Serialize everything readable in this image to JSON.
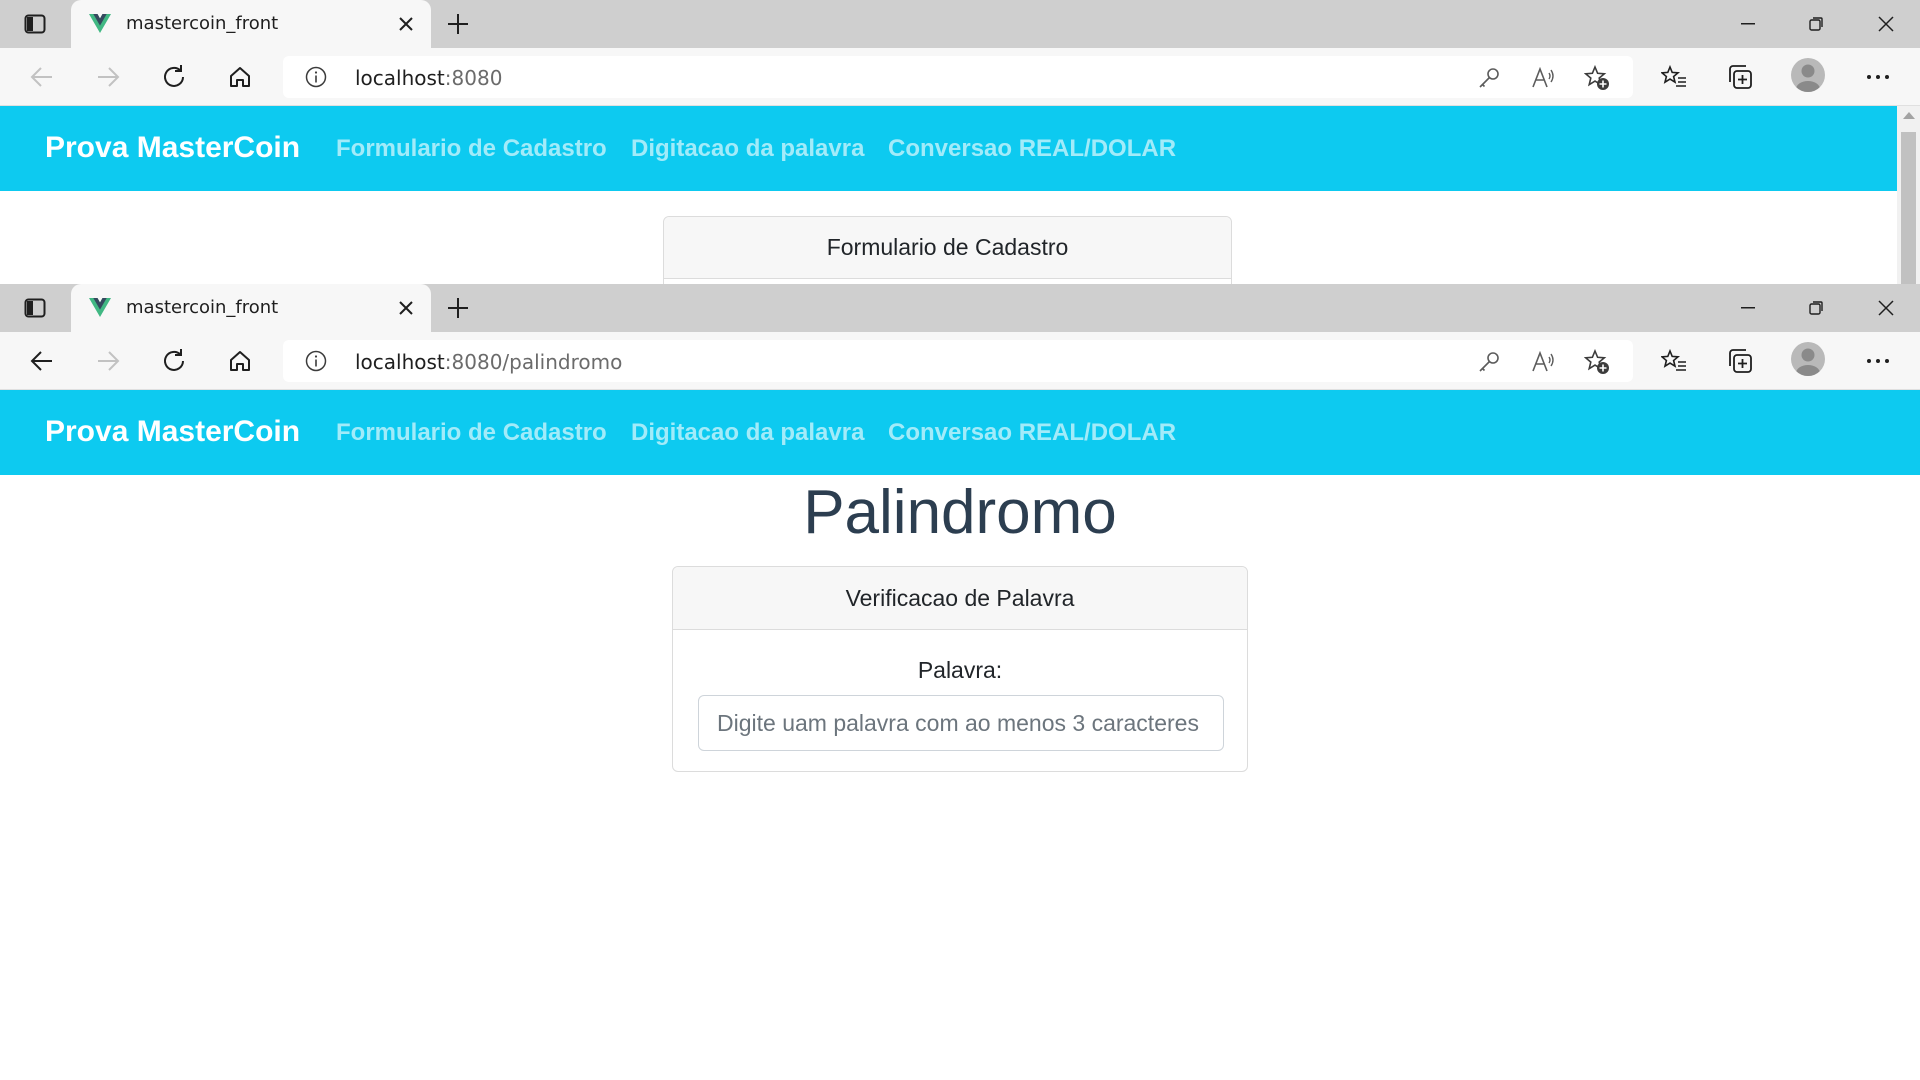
{
  "windows": [
    {
      "tab": {
        "title": "mastercoin_front"
      },
      "address": {
        "host": "localhost",
        "path": ":8080"
      },
      "page": {
        "brand": "Prova MasterCoin",
        "nav": [
          "Formulario de Cadastro",
          "Digitacao da palavra",
          "Conversao REAL/DOLAR"
        ],
        "card_header": "Formulario de Cadastro"
      }
    },
    {
      "tab": {
        "title": "mastercoin_front"
      },
      "address": {
        "host": "localhost",
        "path": ":8080/palindromo"
      },
      "page": {
        "brand": "Prova MasterCoin",
        "nav": [
          "Formulario de Cadastro",
          "Digitacao da palavra",
          "Conversao REAL/DOLAR"
        ],
        "title": "Palindromo",
        "card_header": "Verificacao de Palavra",
        "field_label": "Palavra:",
        "field_value": "",
        "field_placeholder": "Digite uam palavra com ao menos 3 caracteres"
      }
    }
  ],
  "colors": {
    "navbar": "#0dcaf0",
    "tabstrip": "#cfcfcf",
    "heading": "#2c3e50"
  },
  "icons": {
    "tab_actions": "tab-actions-icon",
    "favicon": "vue-logo-icon",
    "close": "close-icon",
    "new_tab": "plus-icon",
    "minimize": "minimize-icon",
    "restore": "restore-icon",
    "back": "arrow-left-icon",
    "forward": "arrow-right-icon",
    "refresh": "refresh-icon",
    "home": "home-icon",
    "info": "info-icon",
    "key": "key-icon",
    "read_aloud": "read-aloud-icon",
    "add_favorite": "star-plus-icon",
    "favorites": "favorites-icon",
    "collections": "collections-icon",
    "more": "more-icon"
  }
}
